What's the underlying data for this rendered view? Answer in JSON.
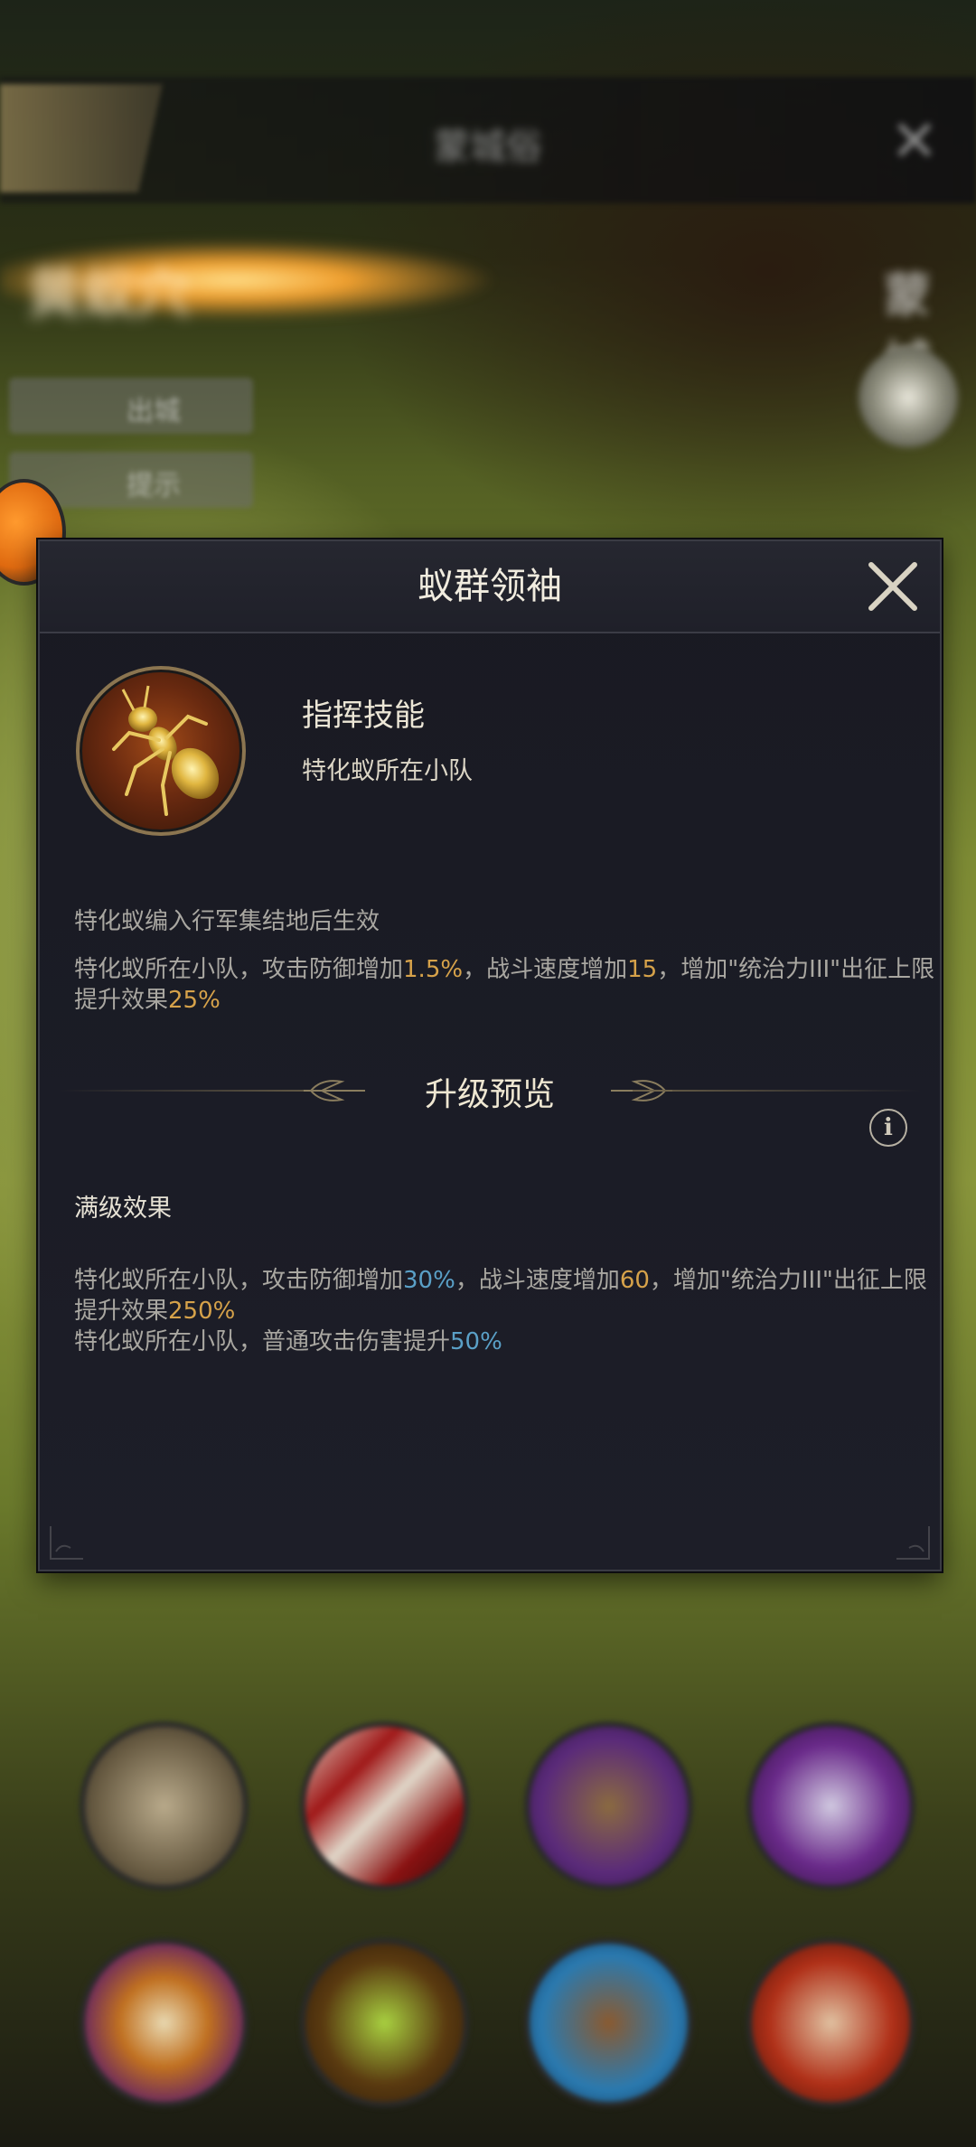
{
  "background": {
    "topbar_title": "蒙城俗",
    "glow_title": "黄蚁穴",
    "side_buttons": [
      "出城",
      "提示"
    ],
    "level_badge": "蒙城"
  },
  "modal": {
    "title": "蚁群领袖",
    "skill": {
      "name": "指挥技能",
      "scope": "特化蚁所在小队"
    },
    "condition": "特化蚁编入行军集结地后生效",
    "current_effect": {
      "p1": "特化蚁所在小队，攻击防御增加",
      "v1": "1.5%",
      "p2": "，战斗速度增加",
      "v2": "15",
      "p3": "，增加\"统治力III\"出征上限提升效果",
      "v3": "25%"
    },
    "upgrade_preview_title": "升级预览",
    "max_level_label": "满级效果",
    "max_effect_1": {
      "p1": "特化蚁所在小队，攻击防御增加",
      "v1": "30%",
      "p2": "，战斗速度增加",
      "v2": "60",
      "p3": "，增加\"统治力III\"出征上限提升效果",
      "v3": "250%"
    },
    "max_effect_2": {
      "p1": "特化蚁所在小队，普通攻击伤害提升",
      "v1": "50%"
    },
    "info_icon": "i"
  },
  "colors": {
    "highlight_gold": "#d6a24a",
    "highlight_blue": "#5aa0c7",
    "modal_bg": "#1b1c26"
  }
}
